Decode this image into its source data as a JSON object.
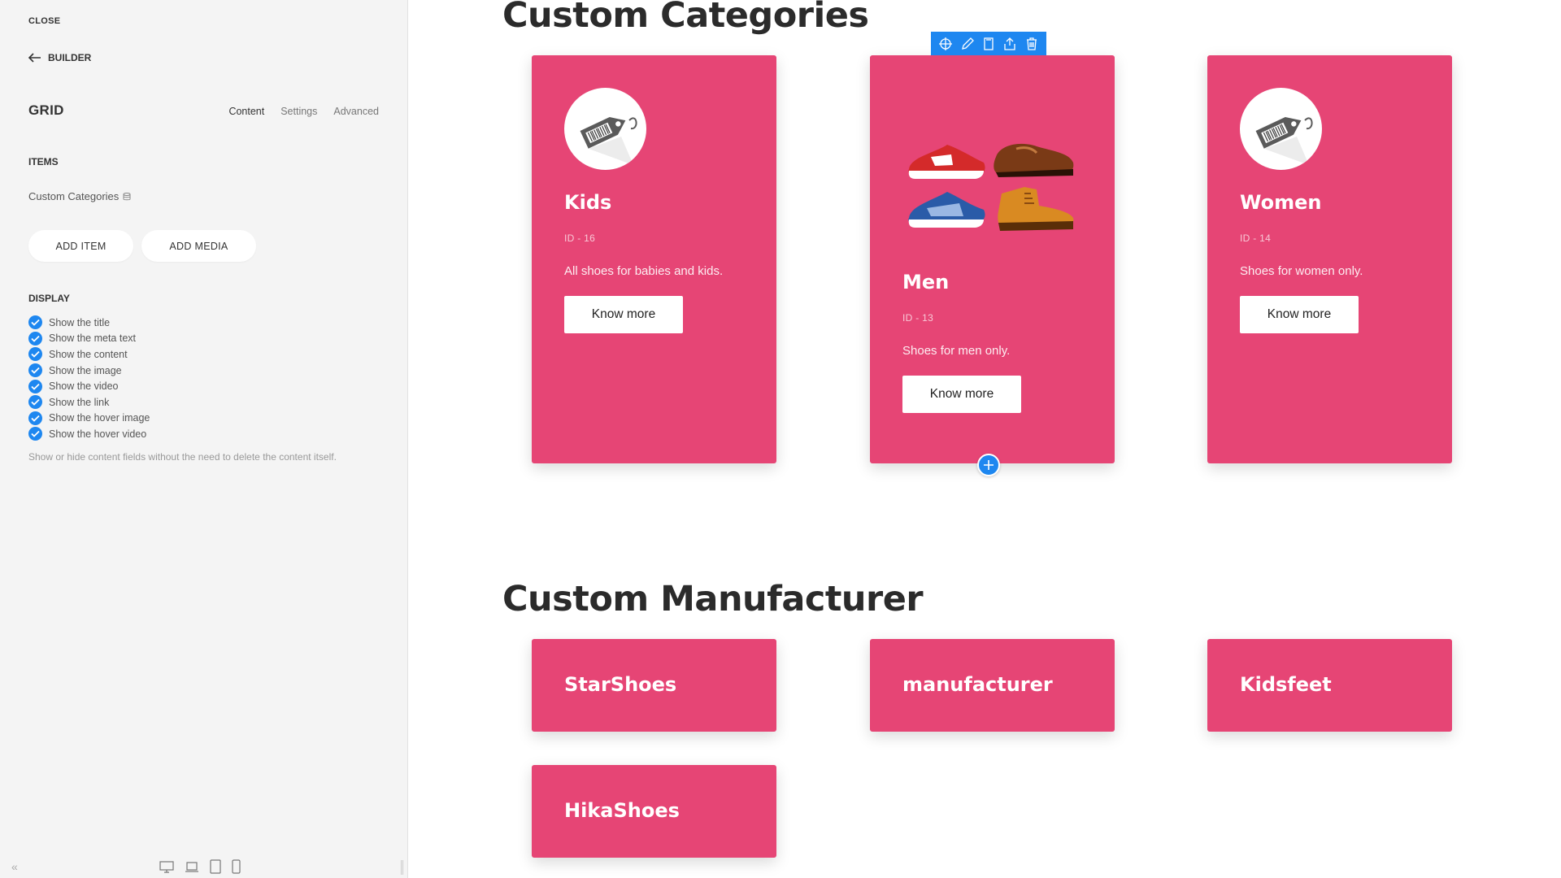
{
  "sidebar": {
    "close_label": "CLOSE",
    "builder_label": "BUILDER",
    "panel_title": "GRID",
    "tabs": [
      {
        "label": "Content",
        "active": true
      },
      {
        "label": "Settings",
        "active": false
      },
      {
        "label": "Advanced",
        "active": false
      }
    ],
    "items_label": "ITEMS",
    "items_source": "Custom Categories",
    "add_item_label": "ADD ITEM",
    "add_media_label": "ADD MEDIA",
    "display_label": "DISPLAY",
    "display_options": [
      {
        "label": "Show the title",
        "checked": true
      },
      {
        "label": "Show the meta text",
        "checked": true
      },
      {
        "label": "Show the content",
        "checked": true
      },
      {
        "label": "Show the image",
        "checked": true
      },
      {
        "label": "Show the video",
        "checked": true
      },
      {
        "label": "Show the link",
        "checked": true
      },
      {
        "label": "Show the hover image",
        "checked": true
      },
      {
        "label": "Show the hover video",
        "checked": true
      }
    ],
    "help_text": "Show or hide content fields without the need to delete the content itself.",
    "collapse_icon": "«",
    "device_icons": [
      "desktop-icon",
      "laptop-icon",
      "tablet-icon",
      "phone-icon"
    ]
  },
  "canvas": {
    "categories_heading": "Custom Categories",
    "categories": [
      {
        "title": "Kids",
        "meta": "ID - 16",
        "text": "All shoes for babies and kids.",
        "button": "Know more",
        "image": "price-tag-icon"
      },
      {
        "title": "Men",
        "meta": "ID - 13",
        "text": "Shoes for men only.",
        "button": "Know more",
        "image": "shoes-image"
      },
      {
        "title": "Women",
        "meta": "ID - 14",
        "text": "Shoes for women only.",
        "button": "Know more",
        "image": "price-tag-icon"
      }
    ],
    "manufacturer_heading": "Custom Manufacturer",
    "manufacturers": [
      "StarShoes",
      "manufacturer",
      "Kidsfeet",
      "HikaShoes"
    ],
    "toolbar_icons": [
      "move-icon",
      "edit-icon",
      "copy-icon",
      "save-icon",
      "delete-icon"
    ],
    "colors": {
      "card": "#e64575",
      "accent": "#1e87f0",
      "sidebar": "#f4f4f4"
    }
  }
}
